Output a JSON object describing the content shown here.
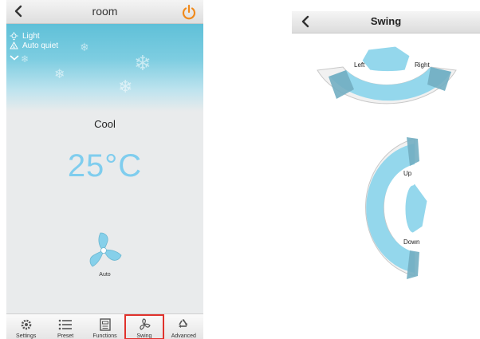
{
  "left_screen": {
    "header": {
      "title": "room"
    },
    "status_rows": [
      {
        "icon": "light-bulb-icon",
        "label": "Light"
      },
      {
        "icon": "auto-quiet-icon",
        "label": "Auto quiet"
      }
    ],
    "mode": "Cool",
    "temperature": "25°C",
    "fan": {
      "label": "Auto"
    },
    "bottom_tabs": [
      {
        "label": "Settings",
        "icon": "gear-icon"
      },
      {
        "label": "Preset",
        "icon": "list-icon"
      },
      {
        "label": "Functions",
        "icon": "document-icon"
      },
      {
        "label": "Swing",
        "icon": "swing-fan-icon",
        "selected": true
      },
      {
        "label": "Advanced",
        "icon": "recycle-icon"
      }
    ]
  },
  "right_screen": {
    "header": {
      "title": "Swing"
    },
    "horizontal_swing": {
      "left_label": "Left",
      "right_label": "Right"
    },
    "vertical_swing": {
      "up_label": "Up",
      "down_label": "Down"
    }
  },
  "colors": {
    "accent_orange": "#f08a1c",
    "temperature_blue": "#7fcdee",
    "swing_blue": "#94d7ec",
    "swing_blue_dark": "#72aec2",
    "selected_outline": "#e0322c"
  }
}
